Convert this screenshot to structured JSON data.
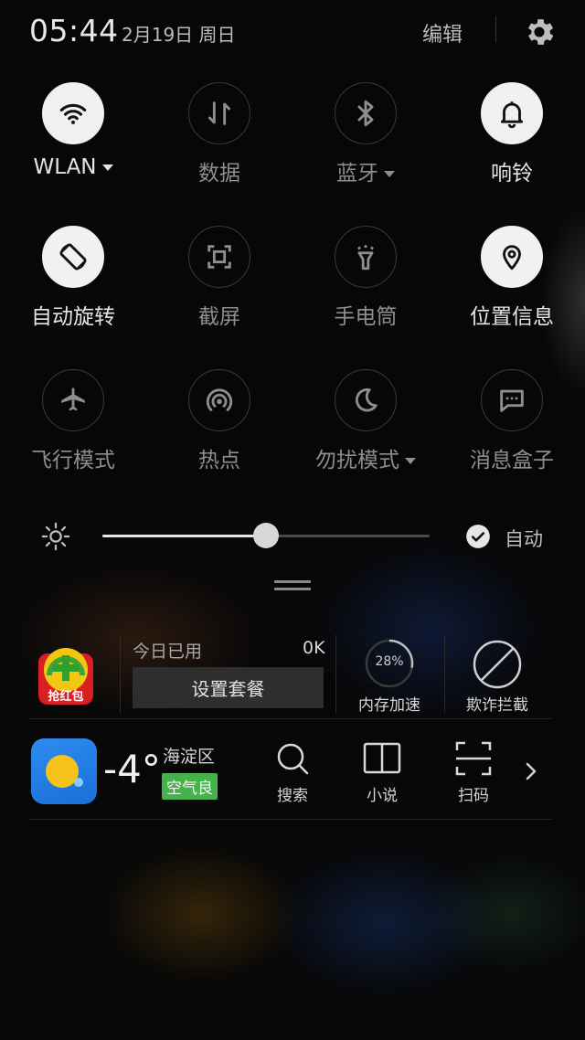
{
  "status": {
    "time": "05:44",
    "date": "2月19日  周日",
    "edit_label": "编辑"
  },
  "toggles": [
    {
      "label": "WLAN",
      "icon": "wifi-icon",
      "on": true,
      "dropdown": true
    },
    {
      "label": "数据",
      "icon": "mobile-data-icon",
      "on": false,
      "dropdown": false
    },
    {
      "label": "蓝牙",
      "icon": "bluetooth-icon",
      "on": false,
      "dropdown": true
    },
    {
      "label": "响铃",
      "icon": "bell-icon",
      "on": true,
      "dropdown": false
    },
    {
      "label": "自动旋转",
      "icon": "auto-rotate-icon",
      "on": true,
      "dropdown": false
    },
    {
      "label": "截屏",
      "icon": "screenshot-icon",
      "on": false,
      "dropdown": false
    },
    {
      "label": "手电筒",
      "icon": "flashlight-icon",
      "on": false,
      "dropdown": false
    },
    {
      "label": "位置信息",
      "icon": "location-icon",
      "on": true,
      "dropdown": false
    },
    {
      "label": "飞行模式",
      "icon": "airplane-icon",
      "on": false,
      "dropdown": false
    },
    {
      "label": "热点",
      "icon": "hotspot-icon",
      "on": false,
      "dropdown": false
    },
    {
      "label": "勿扰模式",
      "icon": "moon-icon",
      "on": false,
      "dropdown": true
    },
    {
      "label": "消息盒子",
      "icon": "message-box-icon",
      "on": false,
      "dropdown": false
    }
  ],
  "brightness": {
    "level": 0.5,
    "auto_label": "自动",
    "auto_checked": true
  },
  "widgets": {
    "red_packet_label": "抢红包",
    "data_usage": {
      "today_label": "今日已用",
      "today_value": "0K",
      "plan_button": "设置套餐"
    },
    "memory": {
      "percent": "28%",
      "percent_value": 0.28,
      "label": "内存加速"
    },
    "fraud": {
      "label": "欺诈拦截"
    },
    "weather": {
      "temp": "-4°",
      "district": "海淀区",
      "air_quality": "空气良"
    },
    "shortcuts": [
      {
        "label": "搜索",
        "icon": "search-icon"
      },
      {
        "label": "小说",
        "icon": "book-icon"
      },
      {
        "label": "扫码",
        "icon": "scan-icon"
      }
    ]
  },
  "colors": {
    "toggle_on_bg": "#f1f1f1",
    "aqi_good": "#46b24c",
    "weather_bg": "#2d8cf0"
  }
}
